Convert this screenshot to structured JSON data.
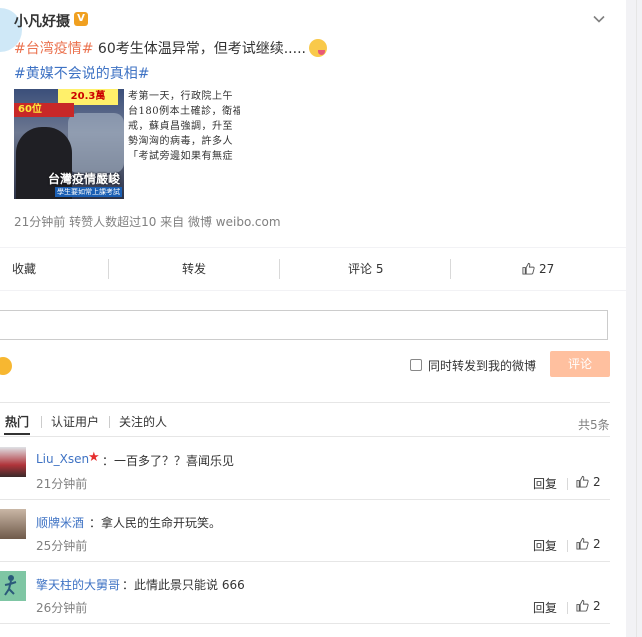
{
  "post": {
    "author": "小凡好摄",
    "verified_badge": "V",
    "topic1": "#台湾疫情#",
    "text": " 60考生体温异常，但考试继续.....",
    "topic2": "#黄媒不会说的真相#",
    "image1": {
      "yellow_label": "20.3萬",
      "red_label": "60位",
      "caption": "台灣疫情嚴峻",
      "caption_sub": "學生要如常上課考試"
    },
    "image2_lines": [
      "考第一天，行政院上午",
      "台180例本土確診，衛福",
      "戒，蘇貞昌強調，升至",
      "勢洶洶的病毒，許多人",
      "「考試旁邊如果有無症"
    ],
    "meta": "21分钟前 转赞人数超过10  来自 微博 weibo.com"
  },
  "actions": {
    "favorite": "收藏",
    "repost": "转发",
    "comment": "评论 5",
    "like_count": "27"
  },
  "composer": {
    "repost_label": "同时转发到我的微博",
    "submit": "评论"
  },
  "tabs": {
    "hot": "热门",
    "verified": "认证用户",
    "following": "关注的人",
    "total": "共5条"
  },
  "comments": [
    {
      "name": "Liu_Xsen",
      "has_star": true,
      "text": "：一百多了？？喜闻乐见",
      "time": "21分钟前",
      "reply": "回复",
      "likes": "2"
    },
    {
      "name": "顺牌米酒",
      "has_star": false,
      "text": "：拿人民的生命开玩笑。",
      "time": "25分钟前",
      "reply": "回复",
      "likes": "2"
    },
    {
      "name": "擎天柱的大舅哥",
      "has_star": false,
      "text": "：此情此景只能说 666",
      "time": "26分钟前",
      "reply": "回复",
      "likes": "2"
    }
  ],
  "colors": {
    "topic": "#eb7350",
    "link": "#3f73c4",
    "button_disabled": "#ffc09f",
    "star": "#e62e2e"
  }
}
